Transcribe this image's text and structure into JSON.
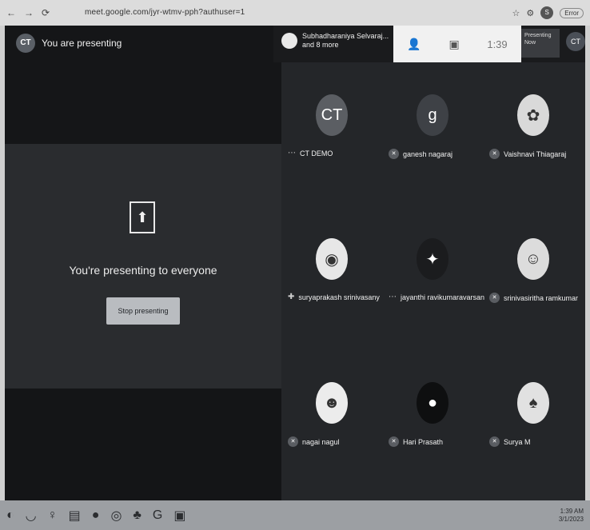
{
  "browser": {
    "url": "meet.google.com/jyr-wtmv-pph?authuser=1",
    "nav": [
      "←",
      "→",
      "⟳"
    ],
    "profile_initial": "S",
    "pill": "Error"
  },
  "presenter_banner": {
    "initials": "CT",
    "label": "You are presenting"
  },
  "present_card": {
    "message": "You're presenting to everyone",
    "stop_button": "Stop presenting"
  },
  "header": {
    "presenter_text_line1": "Subhadharaniya Selvaraj...",
    "presenter_text_line2": "and 8 more",
    "time": "1:39",
    "present_now_line1": "Presenting",
    "present_now_line2": "Now",
    "user_initials": "CT"
  },
  "participants": [
    {
      "name": "CT DEMO",
      "avatar_text": "CT",
      "avatar_color": "#5b5e63",
      "indicator": "dash"
    },
    {
      "name": "ganesh nagaraj",
      "avatar_text": "g",
      "avatar_color": "#3e4146",
      "indicator": "mic"
    },
    {
      "name": "Vaishnavi Thiagaraj",
      "avatar_text": "✿",
      "avatar_color": "#d9d9d9",
      "indicator": "mic"
    },
    {
      "name": "suryaprakash srinivasany",
      "avatar_text": "◉",
      "avatar_color": "#e7e7e7",
      "indicator": "plus"
    },
    {
      "name": "jayanthi ravikumaravarsan",
      "avatar_text": "✦",
      "avatar_color": "#1b1c1e",
      "indicator": "dash"
    },
    {
      "name": "srinivasiritha ramkumar",
      "avatar_text": "☺",
      "avatar_color": "#dcdcdc",
      "indicator": "mic"
    },
    {
      "name": "nagai nagul",
      "avatar_text": "☻",
      "avatar_color": "#ececec",
      "indicator": "mic"
    },
    {
      "name": "Hari Prasath",
      "avatar_text": "●",
      "avatar_color": "#0e0f10",
      "indicator": "mic"
    },
    {
      "name": "Surya M",
      "avatar_text": "♠",
      "avatar_color": "#e1e1e1",
      "indicator": "mic"
    }
  ],
  "taskbar": {
    "icons": [
      "◐",
      "◡",
      "♀",
      "▤",
      "●",
      "◎",
      "♣",
      "G",
      "▣"
    ],
    "tray_time": "1:39 AM",
    "tray_date": "3/1/2023"
  }
}
